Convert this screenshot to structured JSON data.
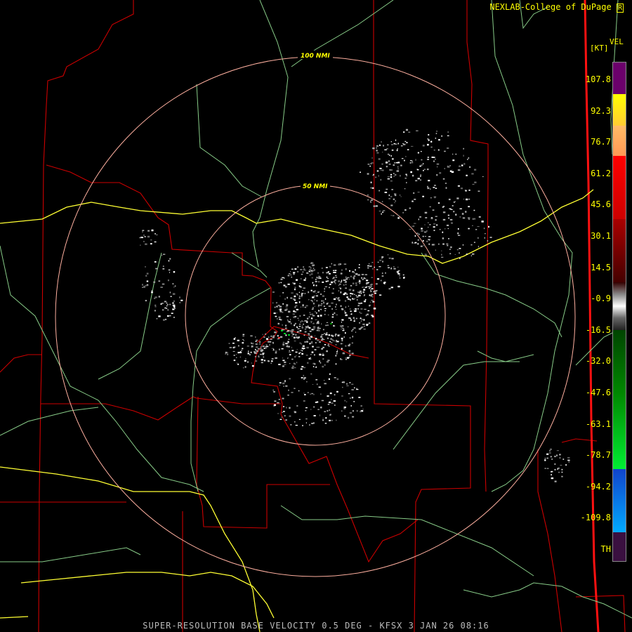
{
  "header": {
    "credit": "NEXLAB-College of DuPage",
    "credit_mark": "R"
  },
  "legend": {
    "product": "VEL",
    "unit": "[KT]",
    "labels": [
      "107.8",
      "92.3",
      "76.7",
      "61.2",
      "45.6",
      "30.1",
      "14.5",
      "-0.9",
      "-16.5",
      "-32.0",
      "-47.6",
      "-63.1",
      "-78.7",
      "-94.2",
      "-109.8",
      "TH"
    ],
    "colors": [
      "#6b006b",
      "#ffff00",
      "#ff9944",
      "#ff0000",
      "#aa0000",
      "#660000",
      "#999999",
      "#006600",
      "#00cc22",
      "#1155dd",
      "#00aaff",
      "#3a1040"
    ]
  },
  "rings": {
    "outer_label": "100 NMI",
    "inner_label": "50 NMI"
  },
  "footer": {
    "product_text": "SUPER-RESOLUTION BASE VELOCITY 0.5 DEG - KFSX 3 JAN 26 08:16"
  },
  "colors": {
    "background": "#000000",
    "text": "#ffff00",
    "boundary_county": "#cc0000",
    "road_interstate": "#ffff33",
    "road_highway": "#88cc88",
    "range_ring": "#ffb0a0",
    "footer_text": "#bbbbbb"
  }
}
